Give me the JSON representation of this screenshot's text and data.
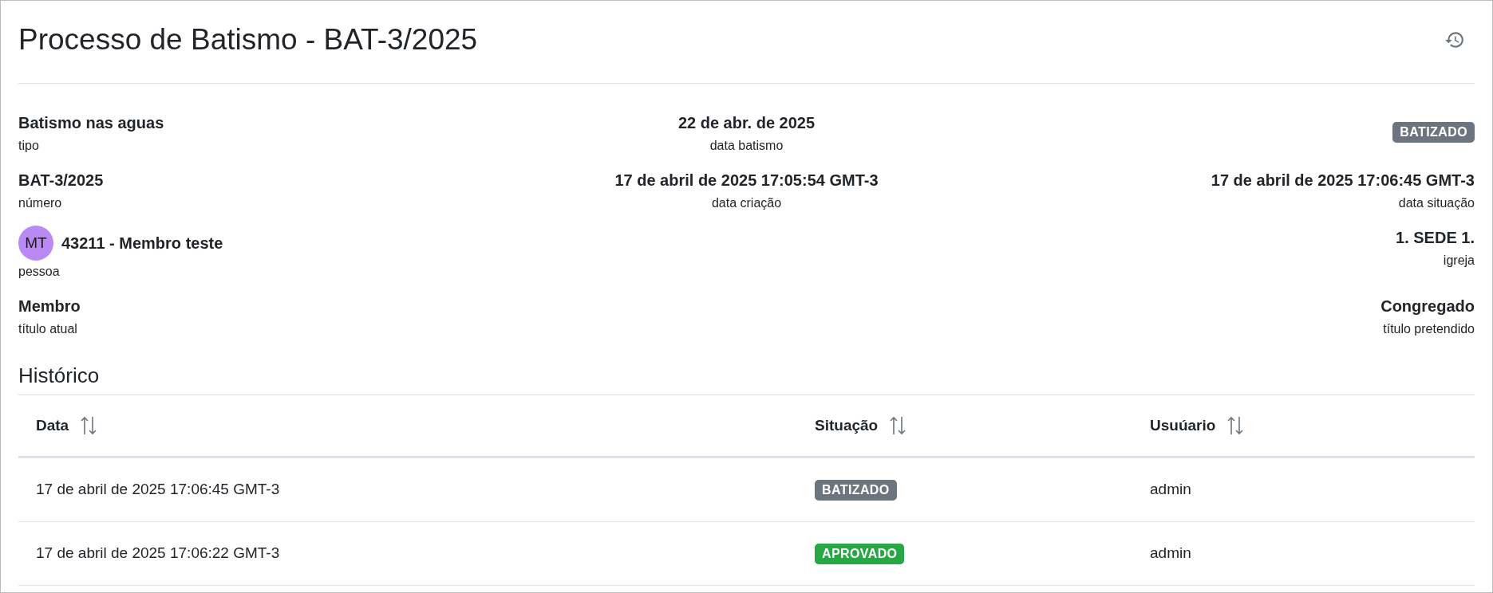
{
  "title": "Processo de Batismo - BAT-3/2025",
  "details": [
    {
      "left": {
        "value": "Batismo nas aguas",
        "label": "tipo"
      },
      "center": {
        "value": "22 de abr. de 2025",
        "label": "data batismo"
      },
      "right": {
        "badge": "BATIZADO",
        "color": "#6c757d"
      }
    },
    {
      "left": {
        "value": "BAT-3/2025",
        "label": "número"
      },
      "center": {
        "value": "17 de abril de 2025 17:05:54 GMT-3",
        "label": "data criação"
      },
      "right": {
        "value": "17 de abril de 2025 17:06:45 GMT-3",
        "label": "data situação"
      }
    },
    {
      "left": {
        "avatar": "MT",
        "value": "43211 - Membro teste",
        "label": "pessoa"
      },
      "right": {
        "value": "1. SEDE 1.",
        "label": "igreja"
      }
    },
    {
      "left": {
        "value": "Membro",
        "label": "título atual"
      },
      "right": {
        "value": "Congregado",
        "label": "título pretendido"
      }
    }
  ],
  "history": {
    "heading": "Histórico",
    "columns": [
      "Data",
      "Situação",
      "Usuúario"
    ],
    "rows": [
      {
        "date": "17 de abril de 2025 17:06:45 GMT-3",
        "status": "BATIZADO",
        "color": "#6c757d",
        "user": "admin"
      },
      {
        "date": "17 de abril de 2025 17:06:22 GMT-3",
        "status": "APROVADO",
        "color": "#28a745",
        "user": "admin"
      }
    ]
  }
}
